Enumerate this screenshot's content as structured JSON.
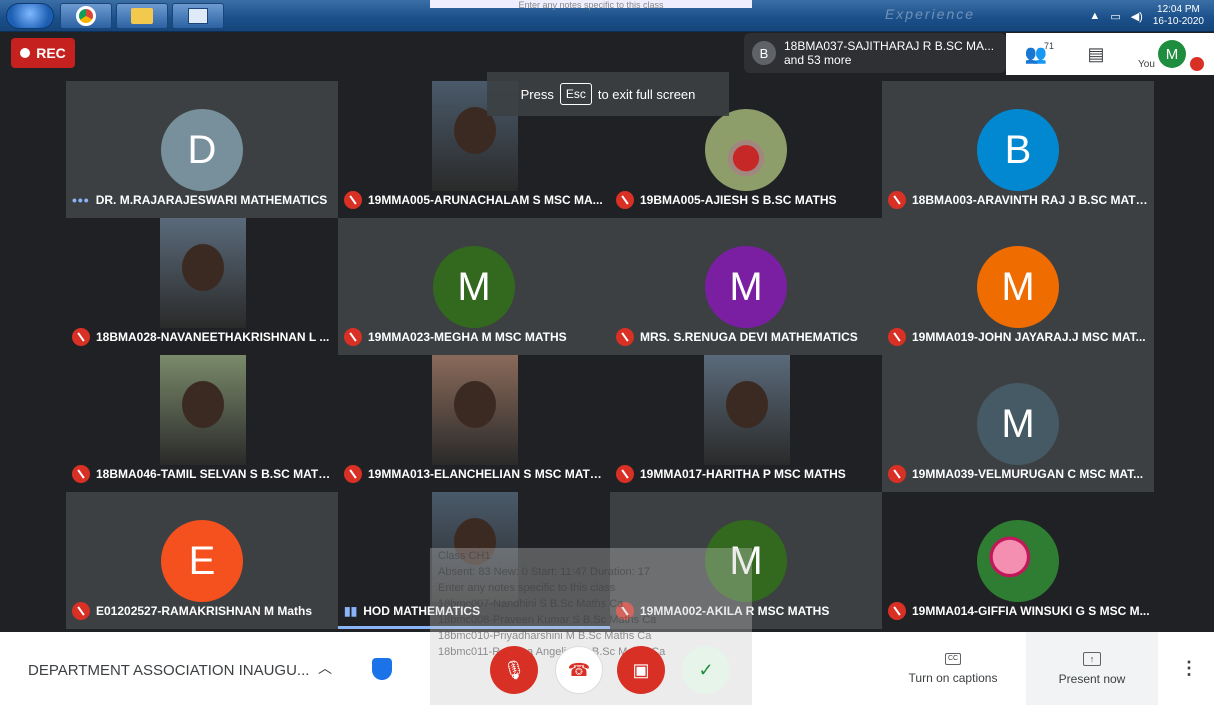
{
  "taskbar": {
    "clock_time": "12:04 PM",
    "clock_date": "16-10-2020",
    "banner": "Experience"
  },
  "header": {
    "rec_label": "REC",
    "fullscreen_prefix": "Press",
    "fullscreen_key": "Esc",
    "fullscreen_suffix": "to exit full screen",
    "speaker_avatar": "B",
    "speaker_line1": "18BMA037-SAJITHARAJ R B.SC MA...",
    "speaker_line2": "and 53 more",
    "participant_count": "71",
    "you_avatar": "M",
    "you_label": "You"
  },
  "tiles": [
    {
      "name": "DR. M.RAJARAJESWARI MATHEMATICS",
      "avatar": "D",
      "color": "#78909c",
      "state": "talking"
    },
    {
      "name": "19MMA005-ARUNACHALAM S MSC MA...",
      "avatar": "",
      "color": "",
      "state": "muted",
      "kind": "video"
    },
    {
      "name": "19BMA005-AJIESH S B.SC MATHS",
      "avatar": "",
      "color": "",
      "state": "muted",
      "kind": "photo"
    },
    {
      "name": "18BMA003-ARAVINTH RAJ J B.SC MATHS",
      "avatar": "B",
      "color": "#0288d1",
      "state": "muted"
    },
    {
      "name": "18BMA028-NAVANEETHAKRISHNAN L ...",
      "avatar": "",
      "color": "",
      "state": "muted",
      "kind": "video"
    },
    {
      "name": "19MMA023-MEGHA M MSC MATHS",
      "avatar": "M",
      "color": "#33691e",
      "state": "muted"
    },
    {
      "name": "MRS. S.RENUGA DEVI MATHEMATICS",
      "avatar": "M",
      "color": "#7b1fa2",
      "state": "muted"
    },
    {
      "name": "19MMA019-JOHN JAYARAJ.J MSC MAT...",
      "avatar": "M",
      "color": "#ef6c00",
      "state": "muted"
    },
    {
      "name": "18BMA046-TAMIL SELVAN S B.SC MATHS",
      "avatar": "",
      "color": "",
      "state": "muted",
      "kind": "video"
    },
    {
      "name": "19MMA013-ELANCHELIAN S MSC MATHS",
      "avatar": "",
      "color": "",
      "state": "muted",
      "kind": "video"
    },
    {
      "name": "19MMA017-HARITHA P MSC MATHS",
      "avatar": "",
      "color": "",
      "state": "muted",
      "kind": "video"
    },
    {
      "name": "19MMA039-VELMURUGAN C MSC MAT...",
      "avatar": "M",
      "color": "#455a64",
      "state": "muted"
    },
    {
      "name": "E01202527-RAMAKRISHNAN M Maths",
      "avatar": "E",
      "color": "#f4511e",
      "state": "muted"
    },
    {
      "name": "HOD MATHEMATICS",
      "avatar": "",
      "color": "",
      "state": "talking-bars",
      "kind": "video"
    },
    {
      "name": "19MMA002-AKILA R MSC MATHS",
      "avatar": "M",
      "color": "#33691e",
      "state": "muted"
    },
    {
      "name": "19MMA014-GIFFIA WINSUKI G S MSC M...",
      "avatar": "",
      "color": "",
      "state": "muted",
      "kind": "photo"
    }
  ],
  "notes_overlay": [
    "Enter any notes specific to this class",
    "Class CH1",
    "Absent: 83   New: 0   Start: 11:47   Duration: 17",
    "18bmc007-Nandhini S B.Sc Maths Ca",
    "18bmc008-Praveen Kumar S B.Sc Maths Ca",
    "18bmc010-Priyadharshini M B.Sc Maths Ca",
    "18bmc011-Reshma Angeline S B.Sc Maths Ca"
  ],
  "bottom": {
    "meeting_title": "DEPARTMENT ASSOCIATION INAUGU...",
    "captions_label": "Turn on captions",
    "present_label": "Present now"
  }
}
